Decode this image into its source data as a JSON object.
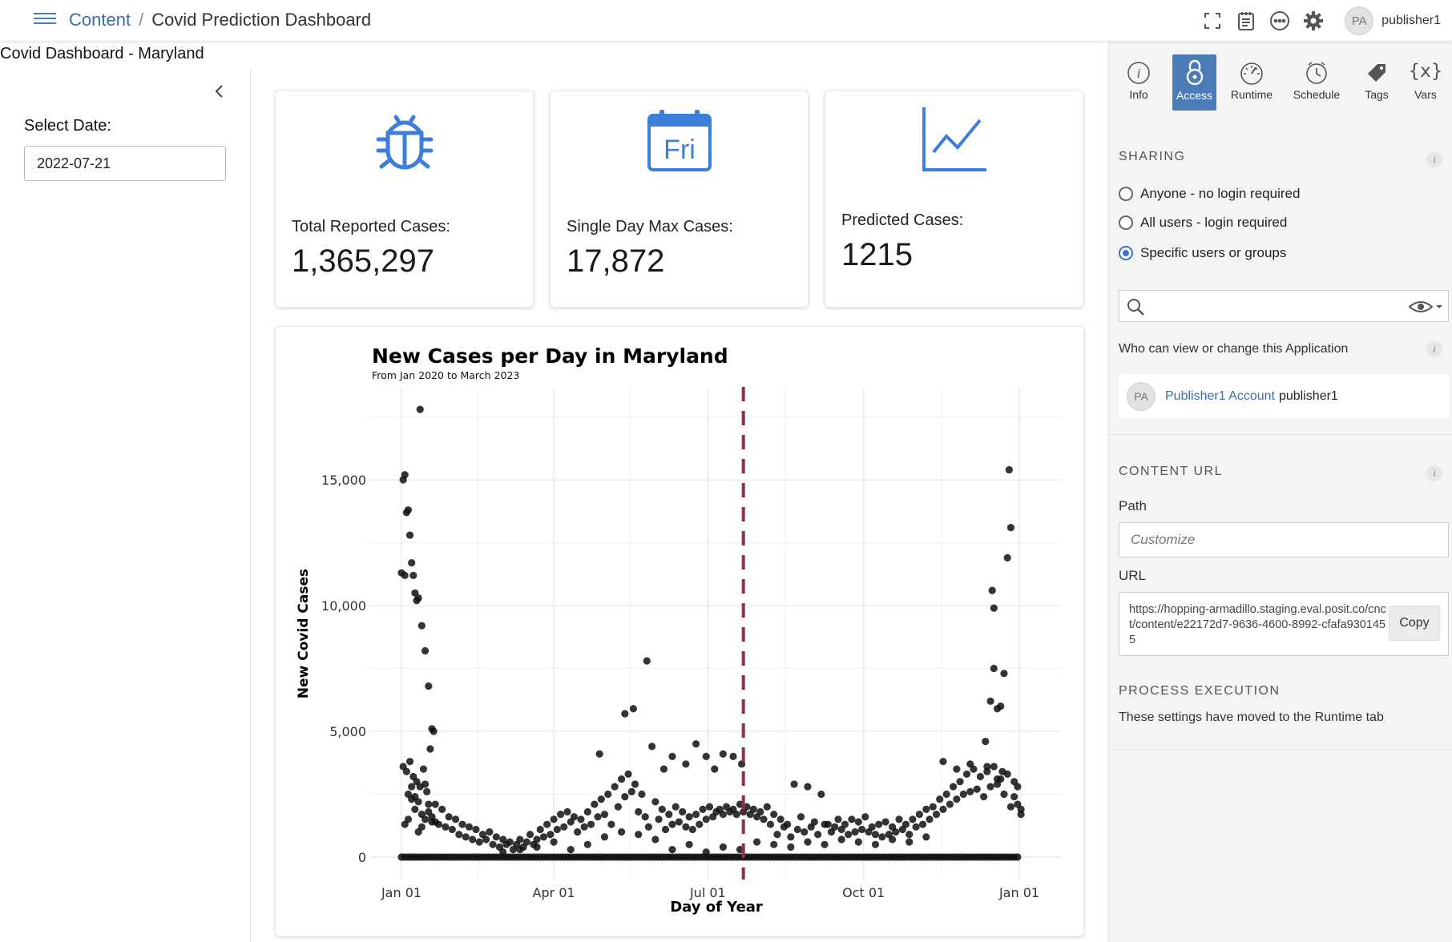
{
  "topbar": {
    "breadcrumb_root": "Content",
    "breadcrumb_sep": "/",
    "breadcrumb_current": "Covid Prediction Dashboard",
    "user_initials": "PA",
    "username": "publisher1"
  },
  "app": {
    "title": "Covid Dashboard - Maryland",
    "date_label": "Select Date:",
    "date_value": "2022-07-21"
  },
  "value_boxes": [
    {
      "icon": "bug-icon",
      "title": "Total Reported Cases:",
      "value": "1,365,297",
      "color": "#3d7edb"
    },
    {
      "icon": "calendar-icon",
      "icon_text": "Fri",
      "title": "Single Day Max Cases:",
      "value": "17,872",
      "color": "#3d7edb"
    },
    {
      "icon": "line-chart-icon",
      "title": "Predicted Cases:",
      "value": "1215",
      "color": "#3d7edb"
    }
  ],
  "chart_data": {
    "type": "scatter",
    "title": "New Cases per Day in Maryland",
    "subtitle": "From Jan 2020 to March 2023",
    "xlabel": "Day of Year",
    "ylabel": "New Covid Cases",
    "xlim": [
      "Dec 29",
      "Jan 10"
    ],
    "ylim": [
      -800,
      18500
    ],
    "x_ticks": [
      "Jan 01",
      "Apr 01",
      "Jul 01",
      "Oct 01",
      "Jan 01"
    ],
    "y_ticks": [
      "0",
      "5,000",
      "10,000",
      "15,000"
    ],
    "y_tick_values": [
      0,
      5000,
      10000,
      15000
    ],
    "grid": true,
    "reference_line": {
      "day_of_year": 202,
      "date": "Jul 21",
      "color": "#8b2f5a",
      "style": "dashed"
    },
    "point_color": "#111111",
    "points": [
      [
        1,
        15000
      ],
      [
        2,
        15200
      ],
      [
        3,
        13700
      ],
      [
        4,
        13800
      ],
      [
        5,
        12800
      ],
      [
        6,
        11700
      ],
      [
        7,
        11200
      ],
      [
        8,
        10500
      ],
      [
        9,
        10200
      ],
      [
        10,
        10300
      ],
      [
        11,
        17800
      ],
      [
        12,
        9200
      ],
      [
        14,
        8200
      ],
      [
        16,
        6800
      ],
      [
        18,
        5100
      ],
      [
        19,
        5000
      ],
      [
        17,
        4300
      ],
      [
        0,
        11300
      ],
      [
        2,
        11200
      ],
      [
        1,
        3600
      ],
      [
        3,
        3400
      ],
      [
        5,
        3800
      ],
      [
        7,
        3200
      ],
      [
        9,
        3000
      ],
      [
        11,
        2800
      ],
      [
        13,
        3500
      ],
      [
        15,
        2600
      ],
      [
        4,
        2500
      ],
      [
        6,
        2300
      ],
      [
        8,
        1900
      ],
      [
        10,
        2200
      ],
      [
        12,
        1700
      ],
      [
        14,
        1500
      ],
      [
        16,
        1800
      ],
      [
        18,
        1400
      ],
      [
        20,
        2100
      ],
      [
        22,
        1300
      ],
      [
        24,
        1900
      ],
      [
        26,
        1200
      ],
      [
        28,
        1600
      ],
      [
        30,
        1100
      ],
      [
        32,
        1500
      ],
      [
        34,
        900
      ],
      [
        36,
        1300
      ],
      [
        38,
        800
      ],
      [
        40,
        1200
      ],
      [
        42,
        700
      ],
      [
        2,
        1300
      ],
      [
        4,
        1500
      ],
      [
        6,
        2800
      ],
      [
        8,
        2400
      ],
      [
        10,
        1000
      ],
      [
        12,
        1200
      ],
      [
        14,
        2900
      ],
      [
        16,
        2100
      ],
      [
        18,
        1600
      ],
      [
        20,
        1400
      ],
      [
        44,
        1100
      ],
      [
        46,
        600
      ],
      [
        48,
        900
      ],
      [
        50,
        700
      ],
      [
        52,
        1000
      ],
      [
        54,
        500
      ],
      [
        56,
        800
      ],
      [
        58,
        400
      ],
      [
        60,
        700
      ],
      [
        62,
        500
      ],
      [
        64,
        600
      ],
      [
        66,
        300
      ],
      [
        68,
        500
      ],
      [
        70,
        700
      ],
      [
        72,
        400
      ],
      [
        74,
        600
      ],
      [
        76,
        900
      ],
      [
        78,
        500
      ],
      [
        80,
        700
      ],
      [
        82,
        1100
      ],
      [
        84,
        800
      ],
      [
        86,
        1300
      ],
      [
        88,
        900
      ],
      [
        90,
        1500
      ],
      [
        92,
        1100
      ],
      [
        94,
        1700
      ],
      [
        96,
        1200
      ],
      [
        98,
        1800
      ],
      [
        100,
        1400
      ],
      [
        102,
        1600
      ],
      [
        104,
        1000
      ],
      [
        106,
        1500
      ],
      [
        108,
        1200
      ],
      [
        110,
        1800
      ],
      [
        112,
        1300
      ],
      [
        114,
        2100
      ],
      [
        116,
        1600
      ],
      [
        118,
        2300
      ],
      [
        120,
        1700
      ],
      [
        122,
        2500
      ],
      [
        124,
        1300
      ],
      [
        126,
        2800
      ],
      [
        128,
        2000
      ],
      [
        130,
        3100
      ],
      [
        132,
        2400
      ],
      [
        134,
        3300
      ],
      [
        136,
        2600
      ],
      [
        138,
        2900
      ],
      [
        140,
        1800
      ],
      [
        142,
        2500
      ],
      [
        117,
        4100
      ],
      [
        132,
        5700
      ],
      [
        137,
        5900
      ],
      [
        145,
        7800
      ],
      [
        148,
        4400
      ],
      [
        155,
        3500
      ],
      [
        160,
        4000
      ],
      [
        168,
        3700
      ],
      [
        174,
        4500
      ],
      [
        180,
        4000
      ],
      [
        185,
        3500
      ],
      [
        190,
        4100
      ],
      [
        196,
        4000
      ],
      [
        201,
        3700
      ],
      [
        144,
        1600
      ],
      [
        146,
        1200
      ],
      [
        150,
        2200
      ],
      [
        152,
        1500
      ],
      [
        154,
        1900
      ],
      [
        156,
        1100
      ],
      [
        158,
        1700
      ],
      [
        160,
        1300
      ],
      [
        162,
        2000
      ],
      [
        164,
        1400
      ],
      [
        166,
        1800
      ],
      [
        168,
        1200
      ],
      [
        170,
        1600
      ],
      [
        172,
        1100
      ],
      [
        174,
        1700
      ],
      [
        176,
        1300
      ],
      [
        178,
        1900
      ],
      [
        180,
        1500
      ],
      [
        182,
        2000
      ],
      [
        184,
        1600
      ],
      [
        186,
        1800
      ],
      [
        188,
        1900
      ],
      [
        190,
        1700
      ],
      [
        192,
        2000
      ],
      [
        194,
        1800
      ],
      [
        196,
        1900
      ],
      [
        198,
        1700
      ],
      [
        200,
        2100
      ],
      [
        202,
        1800
      ],
      [
        204,
        2000
      ],
      [
        206,
        1700
      ],
      [
        208,
        1900
      ],
      [
        210,
        1600
      ],
      [
        212,
        1800
      ],
      [
        214,
        1500
      ],
      [
        216,
        2000
      ],
      [
        220,
        1700
      ],
      [
        224,
        1500
      ],
      [
        228,
        1300
      ],
      [
        232,
        2900
      ],
      [
        236,
        1600
      ],
      [
        240,
        2800
      ],
      [
        244,
        1400
      ],
      [
        248,
        2500
      ],
      [
        252,
        1300
      ],
      [
        256,
        1200
      ],
      [
        218,
        1300
      ],
      [
        222,
        900
      ],
      [
        226,
        1200
      ],
      [
        230,
        800
      ],
      [
        234,
        1100
      ],
      [
        238,
        1000
      ],
      [
        242,
        1200
      ],
      [
        246,
        900
      ],
      [
        250,
        1300
      ],
      [
        254,
        1000
      ],
      [
        258,
        1500
      ],
      [
        260,
        1100
      ],
      [
        262,
        1300
      ],
      [
        264,
        900
      ],
      [
        266,
        1500
      ],
      [
        268,
        1000
      ],
      [
        270,
        1400
      ],
      [
        272,
        1100
      ],
      [
        274,
        1600
      ],
      [
        276,
        1000
      ],
      [
        278,
        1200
      ],
      [
        280,
        900
      ],
      [
        282,
        1300
      ],
      [
        284,
        800
      ],
      [
        286,
        1400
      ],
      [
        288,
        900
      ],
      [
        290,
        1200
      ],
      [
        292,
        1000
      ],
      [
        294,
        1500
      ],
      [
        296,
        1100
      ],
      [
        298,
        1300
      ],
      [
        300,
        900
      ],
      [
        302,
        1500
      ],
      [
        304,
        1200
      ],
      [
        306,
        1700
      ],
      [
        308,
        1300
      ],
      [
        310,
        1900
      ],
      [
        312,
        1500
      ],
      [
        314,
        2000
      ],
      [
        316,
        1700
      ],
      [
        318,
        2300
      ],
      [
        320,
        1900
      ],
      [
        322,
        2500
      ],
      [
        324,
        2100
      ],
      [
        326,
        2800
      ],
      [
        328,
        2300
      ],
      [
        330,
        3000
      ],
      [
        332,
        2500
      ],
      [
        334,
        3300
      ],
      [
        336,
        2600
      ],
      [
        338,
        3500
      ],
      [
        340,
        2700
      ],
      [
        342,
        3200
      ],
      [
        344,
        2400
      ],
      [
        346,
        3400
      ],
      [
        348,
        2800
      ],
      [
        350,
        3600
      ],
      [
        352,
        2900
      ],
      [
        354,
        3100
      ],
      [
        356,
        2500
      ],
      [
        320,
        3800
      ],
      [
        328,
        3500
      ],
      [
        336,
        3700
      ],
      [
        346,
        3600
      ],
      [
        352,
        3100
      ],
      [
        358,
        3300
      ],
      [
        360,
        2000
      ],
      [
        362,
        2400
      ],
      [
        364,
        2100
      ],
      [
        366,
        1700
      ],
      [
        348,
        6200
      ],
      [
        350,
        7500
      ],
      [
        352,
        5900
      ],
      [
        350,
        9900
      ],
      [
        349,
        10600
      ],
      [
        354,
        6000
      ],
      [
        356,
        7300
      ],
      [
        358,
        11900
      ],
      [
        360,
        13100
      ],
      [
        359,
        15400
      ],
      [
        345,
        4600
      ],
      [
        355,
        3400
      ],
      [
        362,
        3000
      ],
      [
        364,
        2800
      ],
      [
        366,
        1900
      ],
      [
        150,
        700
      ],
      [
        160,
        300
      ],
      [
        170,
        500
      ],
      [
        180,
        200
      ],
      [
        190,
        400
      ],
      [
        200,
        300
      ],
      [
        210,
        600
      ],
      [
        220,
        500
      ],
      [
        230,
        400
      ],
      [
        240,
        600
      ],
      [
        250,
        500
      ],
      [
        260,
        700
      ],
      [
        270,
        600
      ],
      [
        280,
        500
      ],
      [
        290,
        700
      ],
      [
        300,
        600
      ],
      [
        310,
        800
      ],
      [
        100,
        300
      ],
      [
        110,
        500
      ],
      [
        120,
        800
      ],
      [
        130,
        1000
      ],
      [
        140,
        900
      ],
      [
        60,
        200
      ],
      [
        70,
        300
      ],
      [
        80,
        400
      ],
      [
        90,
        600
      ]
    ],
    "zero_points_every_days": 2
  },
  "right_panel": {
    "tabs": [
      {
        "label": "Info",
        "icon": "info-icon"
      },
      {
        "label": "Access",
        "icon": "lock-icon",
        "active": true
      },
      {
        "label": "Runtime",
        "icon": "gauge-icon"
      },
      {
        "label": "Schedule",
        "icon": "clock-icon"
      },
      {
        "label": "Tags",
        "icon": "tag-icon"
      },
      {
        "label": "Vars",
        "icon": "vars-icon",
        "icon_text": "{x}"
      }
    ],
    "sharing_heading": "SHARING",
    "sharing_options": [
      {
        "label": "Anyone - no login required",
        "selected": false
      },
      {
        "label": "All users - login required",
        "selected": false
      },
      {
        "label": "Specific users or groups",
        "selected": true
      }
    ],
    "who_can_label": "Who can view or change this Application",
    "acl_initials": "PA",
    "acl_name": "Publisher1 Account",
    "acl_user": "publisher1",
    "content_url_heading": "CONTENT URL",
    "path_label": "Path",
    "path_placeholder": "Customize",
    "url_label": "URL",
    "url_value": "https://hopping-armadillo.staging.eval.posit.co/cnct/content/e22172d7-9636-4600-8992-cfafa9301455",
    "copy_label": "Copy",
    "process_heading": "PROCESS EXECUTION",
    "process_note": "These settings have moved to the Runtime tab",
    "info_glyph": "i"
  },
  "colors": {
    "accent": "#4a7cb8",
    "link": "#3a6ea5",
    "value_box_icon": "#3d7edb",
    "reference_line": "#8b2f5a"
  }
}
